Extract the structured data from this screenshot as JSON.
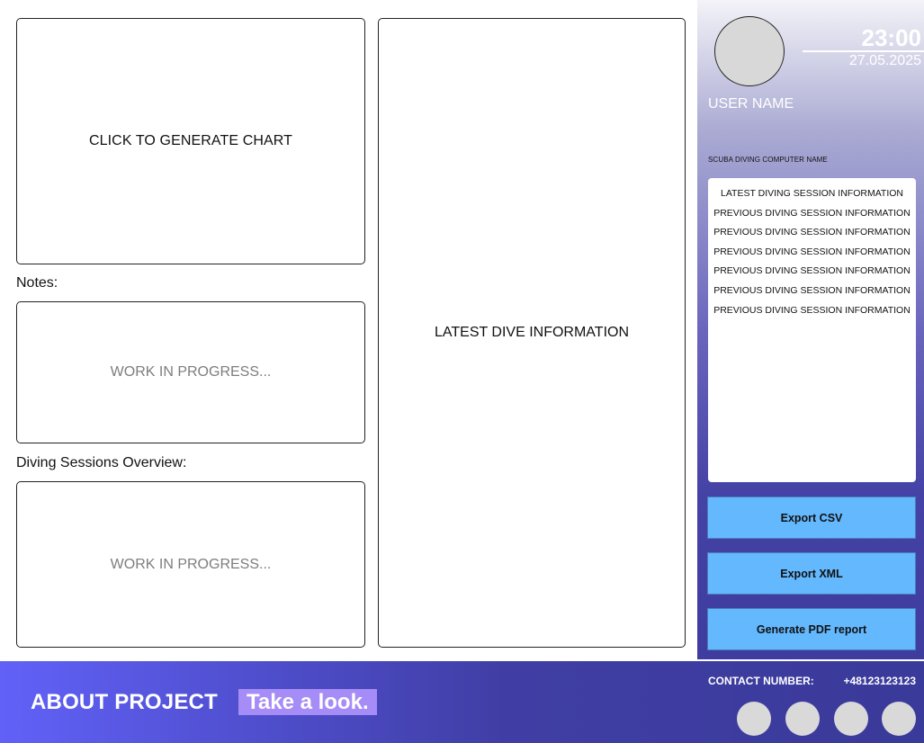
{
  "main": {
    "chart_button_label": "CLICK TO GENERATE CHART",
    "notes_label": "Notes:",
    "notes_placeholder": "WORK IN PROGRESS...",
    "overview_label": "Diving Sessions Overview:",
    "overview_placeholder": "WORK IN PROGRESS...",
    "latest_dive_label": "LATEST DIVE INFORMATION"
  },
  "sidebar": {
    "time": "23:00",
    "date": "27.05.2025",
    "user_name": "USER NAME",
    "computer_name": "SCUBA DIVING COMPUTER NAME",
    "sessions": [
      "LATEST DIVING SESSION INFORMATION",
      "PREVIOUS DIVING SESSION INFORMATION",
      "PREVIOUS DIVING SESSION INFORMATION",
      "PREVIOUS DIVING SESSION INFORMATION",
      "PREVIOUS DIVING SESSION INFORMATION",
      "PREVIOUS DIVING SESSION INFORMATION",
      "PREVIOUS DIVING SESSION INFORMATION"
    ],
    "export_csv": "Export CSV",
    "export_xml": "Export XML",
    "generate_pdf": "Generate PDF report"
  },
  "footer": {
    "about": "ABOUT PROJECT",
    "take_look": "Take a look.",
    "contact_label": "CONTACT NUMBER:",
    "contact_number": "+48123123123"
  },
  "colors": {
    "button_blue": "#64b8fe",
    "footer_start": "#6161f8",
    "footer_end": "#3a3a9a",
    "take_look_bg": "#a58cf6"
  }
}
